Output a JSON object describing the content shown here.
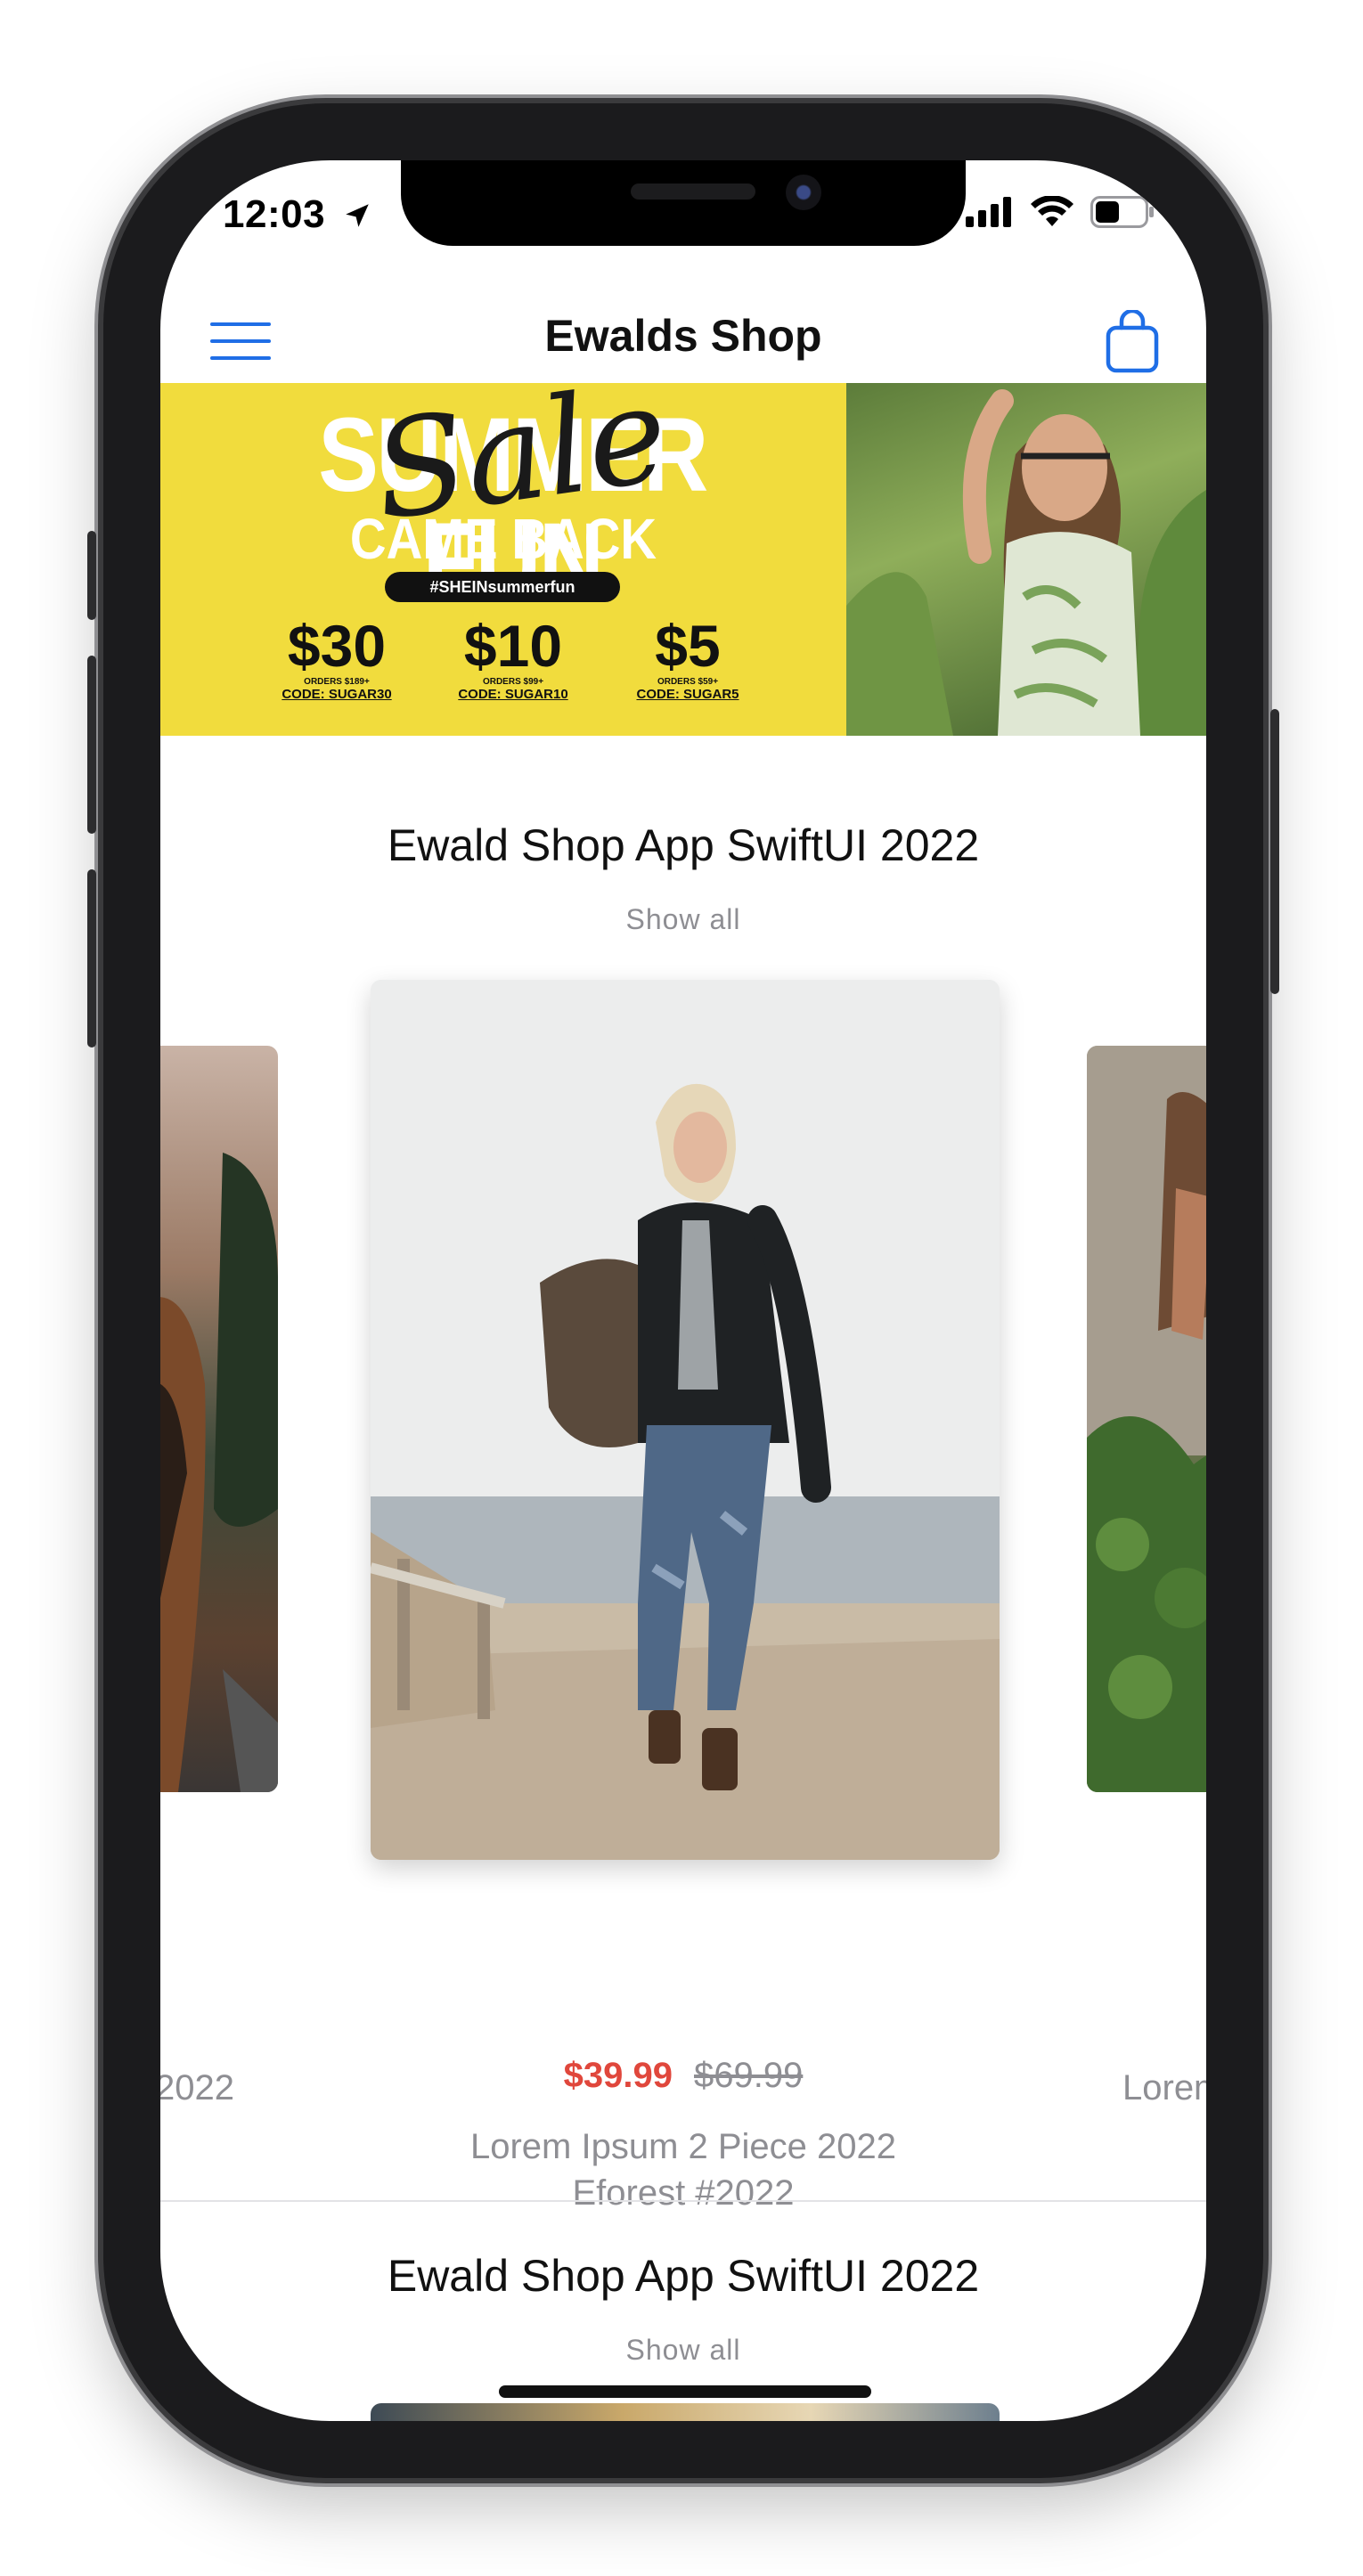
{
  "status": {
    "time": "12:03"
  },
  "header": {
    "title": "Ewalds Shop",
    "menu_icon": "hamburger-menu-icon",
    "cart_icon": "shopping-bag-icon"
  },
  "banner": {
    "headline": "SUMMER FUN",
    "script": "Sale",
    "subline": "CAME BACK",
    "hashtag": "#SHEINsummerfun",
    "offers": [
      {
        "amount": "30",
        "cond": "ORDERS $189+",
        "code": "CODE: SUGAR30"
      },
      {
        "amount": "10",
        "cond": "ORDERS $99+",
        "code": "CODE: SUGAR10"
      },
      {
        "amount": "5",
        "cond": "ORDERS $59+",
        "code": "CODE: SUGAR5"
      }
    ],
    "colors": {
      "background": "#f1dc3d",
      "text": "#ffffff"
    }
  },
  "sections": [
    {
      "title": "Ewald Shop App SwiftUI 2022",
      "show_all": "Show all",
      "featured": {
        "price": "$39.99",
        "old_price": "$69.99",
        "name_line1": "Lorem Ipsum 2 Piece 2022",
        "name_line2": "Eforest #2022"
      },
      "left_peek_label": "2022",
      "right_peek_label": "Lorem"
    },
    {
      "title": "Ewald Shop App SwiftUI 2022",
      "show_all": "Show all"
    }
  ],
  "colors": {
    "accent": "#1f6ee6",
    "sale_price": "#e0473c",
    "secondary_text": "#8e8e93"
  }
}
